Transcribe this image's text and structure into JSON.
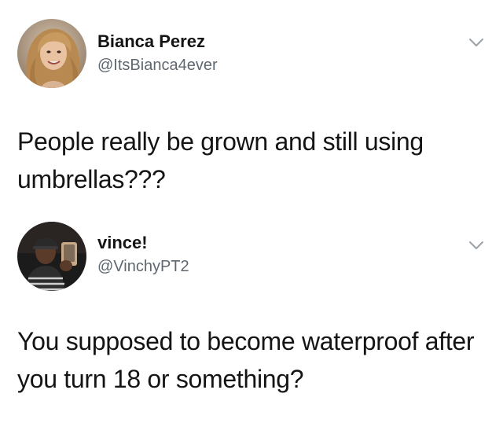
{
  "tweets": [
    {
      "display_name": "Bianca Perez",
      "handle": "@ItsBianca4ever",
      "text": "People really be grown and still using umbrellas???",
      "avatar_icon": "profile-photo-blonde-woman",
      "menu_icon": "chevron-down-icon"
    },
    {
      "display_name": "vince!",
      "handle": "@VinchyPT2",
      "text": "You supposed to become waterproof after you turn 18 or something?",
      "avatar_icon": "profile-photo-selfie-man",
      "menu_icon": "chevron-down-icon"
    }
  ],
  "colors": {
    "text": "#141414",
    "handle": "#5f6770",
    "chevron": "#9aa1a8",
    "background": "#ffffff"
  }
}
